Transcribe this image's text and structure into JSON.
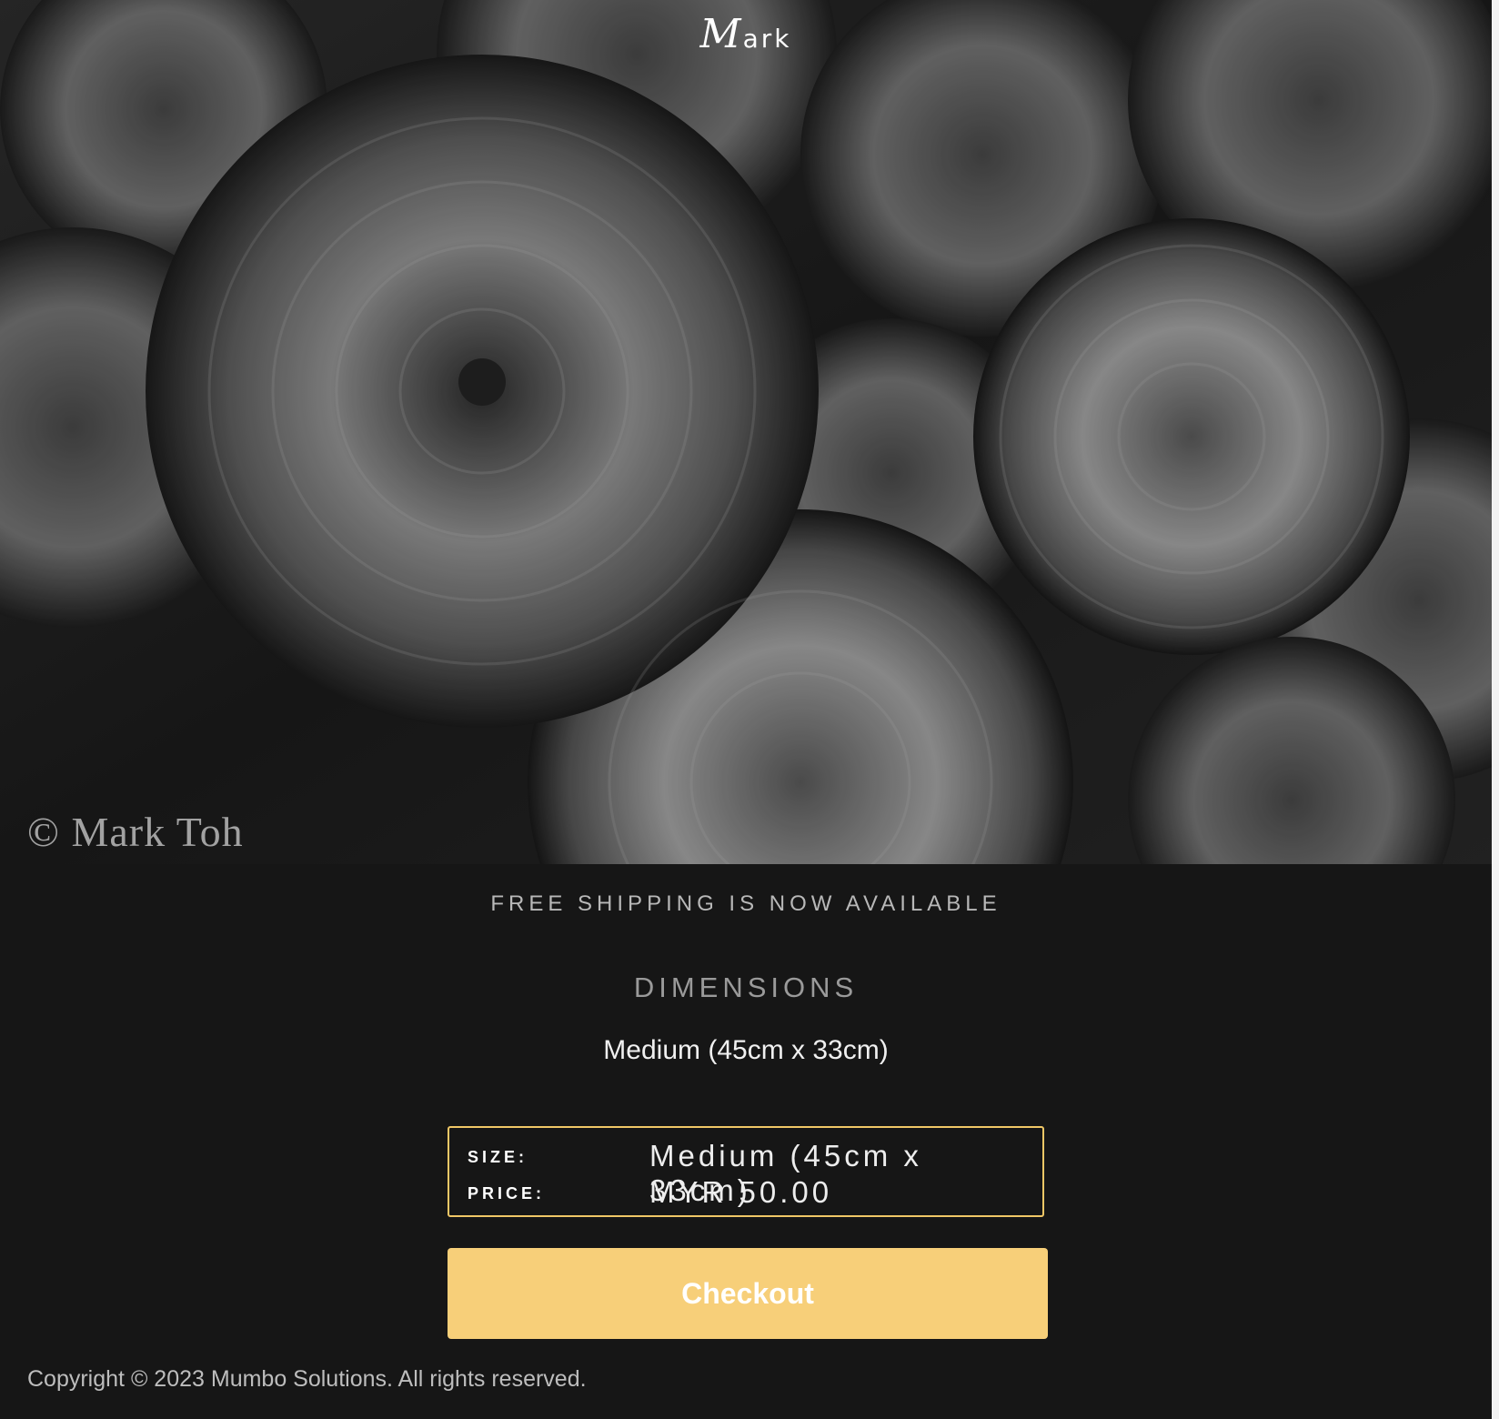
{
  "header": {
    "brand_initial": "M",
    "brand_rest": "ark"
  },
  "hero": {
    "watermark": "© Mark Toh",
    "image_subject": "black-and-white-flowers-photo"
  },
  "shipping_notice": "FREE SHIPPING IS NOW AVAILABLE",
  "dimensions": {
    "title": "DIMENSIONS",
    "value": "Medium (45cm x 33cm)"
  },
  "summary": {
    "size_label": "SIZE:",
    "size_value": "Medium (45cm x 33cm)",
    "price_label": "PRICE:",
    "price_value": "MYR 50.00"
  },
  "checkout_label": "Checkout",
  "footer": {
    "copyright": "Copyright © 2023 Mumbo Solutions. All rights reserved."
  },
  "colors": {
    "background": "#161616",
    "accent": "#f7cf79",
    "border_accent": "#f0c766"
  }
}
